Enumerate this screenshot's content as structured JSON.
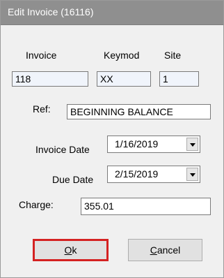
{
  "window": {
    "title": "Edit Invoice (16116)"
  },
  "header_labels": {
    "invoice": "Invoice",
    "keymod": "Keymod",
    "site": "Site"
  },
  "fields": {
    "invoice_value": "118",
    "keymod_value": "XX",
    "site_value": "1",
    "ref_label": "Ref:",
    "ref_value": "BEGINNING BALANCE",
    "invoice_date_label": "Invoice Date",
    "invoice_date_value": "1/16/2019",
    "due_date_label": "Due Date",
    "due_date_value": "2/15/2019",
    "charge_label": "Charge:",
    "charge_value": "355.01"
  },
  "buttons": {
    "ok_mnemonic": "O",
    "ok_rest": "k",
    "cancel_mnemonic": "C",
    "cancel_rest": "ancel"
  },
  "colors": {
    "highlight_border": "#d42222",
    "titlebar": "#8f8f8f"
  }
}
